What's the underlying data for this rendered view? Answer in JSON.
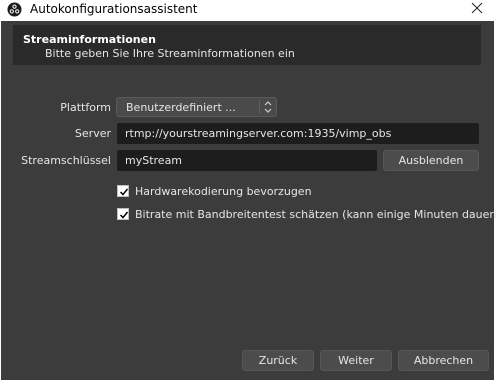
{
  "window": {
    "title": "Autokonfigurationsassistent",
    "app_icon": "obs-logo-icon",
    "close_icon": "close-icon"
  },
  "header": {
    "title": "Streaminformationen",
    "subtitle": "Bitte geben Sie Ihre Streaminformationen ein"
  },
  "form": {
    "platform_label": "Plattform",
    "platform_value": "Benutzerdefiniert ...",
    "server_label": "Server",
    "server_value": "rtmp://yourstreamingserver.com:1935/vimp_obs",
    "key_label": "Streamschlüssel",
    "key_value": "myStream",
    "hide_button": "Ausblenden"
  },
  "options": {
    "hw_encoding": {
      "label": "Hardwarekodierung bevorzugen",
      "checked": true
    },
    "bandwidth_test": {
      "label": "Bitrate mit Bandbreitentest schätzen (kann einige Minuten dauern)",
      "checked": true
    }
  },
  "footer": {
    "back": "Zurück",
    "next": "Weiter",
    "cancel": "Abbrechen"
  }
}
